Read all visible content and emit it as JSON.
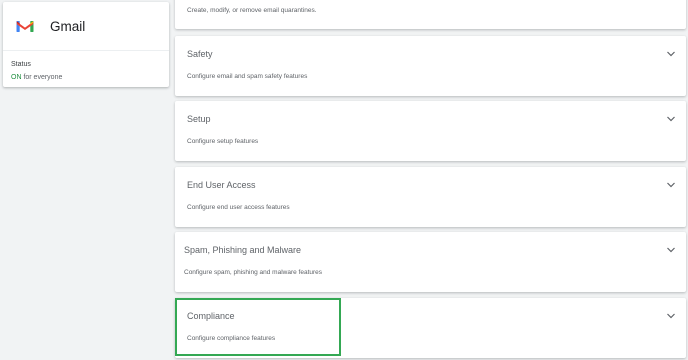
{
  "app": {
    "name": "Gmail",
    "logo_icon": "gmail-logo-icon",
    "status_label": "Status",
    "status_on": "ON",
    "status_rest": " for everyone"
  },
  "sections": [
    {
      "title": "",
      "description": "Create, modify, or remove email quarantines."
    },
    {
      "title": "Safety",
      "description": "Configure email and spam safety features"
    },
    {
      "title": "Setup",
      "description": "Configure setup features"
    },
    {
      "title": "End User Access",
      "description": "Configure end user access features"
    },
    {
      "title": "Spam, Phishing and Malware",
      "description": "Configure spam, phishing and malware features"
    },
    {
      "title": "Compliance",
      "description": "Configure compliance features"
    }
  ],
  "colors": {
    "status_on": "#1e8e3e",
    "highlight": "#34a853"
  },
  "icons": {
    "expand": "chevron-down-icon"
  }
}
